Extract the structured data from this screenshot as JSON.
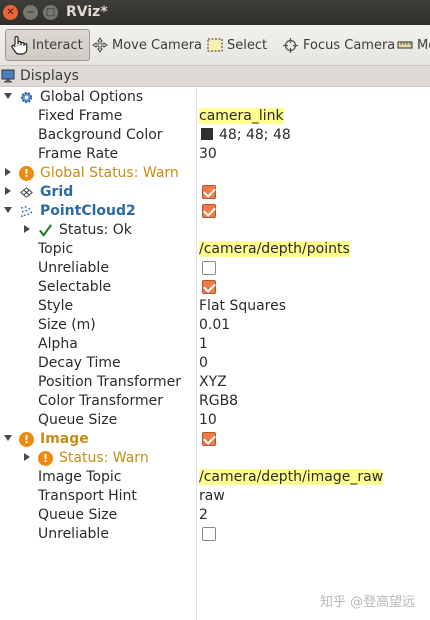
{
  "window": {
    "title": "RViz*"
  },
  "toolbar": {
    "interact": "Interact",
    "move_camera": "Move Camera",
    "select": "Select",
    "focus_camera": "Focus Camera",
    "measure": "Me"
  },
  "panel": {
    "title": "Displays"
  },
  "tree": {
    "global_options": "Global Options",
    "fixed_frame_label": "Fixed Frame",
    "fixed_frame_value": "camera_link",
    "background_label": "Background Color",
    "background_value": "48; 48; 48",
    "frame_rate_label": "Frame Rate",
    "frame_rate_value": "30",
    "global_status": "Global Status: Warn",
    "grid": "Grid",
    "grid_enabled": true,
    "pointcloud": "PointCloud2",
    "pointcloud_enabled": true,
    "pc_status": "Status: Ok",
    "topic_label": "Topic",
    "topic_value": "/camera/depth/points",
    "unreliable_label": "Unreliable",
    "unreliable_checked": false,
    "selectable_label": "Selectable",
    "selectable_checked": true,
    "style_label": "Style",
    "style_value": "Flat Squares",
    "size_label": "Size (m)",
    "size_value": "0.01",
    "alpha_label": "Alpha",
    "alpha_value": "1",
    "decay_label": "Decay Time",
    "decay_value": "0",
    "pos_transformer_label": "Position Transformer",
    "pos_transformer_value": "XYZ",
    "color_transformer_label": "Color Transformer",
    "color_transformer_value": "RGB8",
    "queue_label": "Queue Size",
    "queue_value": "10",
    "image": "Image",
    "image_enabled": true,
    "image_status": "Status: Warn",
    "image_topic_label": "Image Topic",
    "image_topic_value": "/camera/depth/image_raw",
    "transport_label": "Transport Hint",
    "transport_value": "raw",
    "image_queue_label": "Queue Size",
    "image_queue_value": "2",
    "image_unreliable_label": "Unreliable",
    "image_unreliable_checked": false
  },
  "watermark": "知乎 @登高望远",
  "colors": {
    "highlight": "#ffff8e",
    "warn": "#c78d12",
    "blue": "#2d6aa3",
    "checkbox_on": "#ee7c49"
  }
}
